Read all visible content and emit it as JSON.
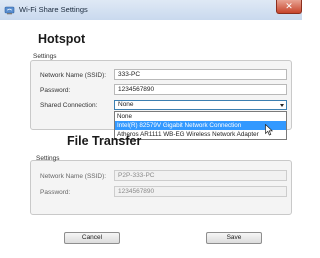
{
  "window": {
    "title": "Wi-Fi Share Settings",
    "close_glyph": "✕",
    "app_icon": "wifi-app-icon"
  },
  "hotspot": {
    "heading": "Hotspot",
    "group_label": "Settings",
    "ssid_label": "Network Name (SSID):",
    "ssid_value": "333-PC",
    "password_label": "Password:",
    "password_value": "1234567890",
    "shared_label": "Shared Connection:",
    "shared_value": "None",
    "options": [
      "None",
      "Intel(R) 82579V Gigabit Network Connection",
      "Atheros AR1111 WB-EG Wireless Network Adapter"
    ],
    "highlighted_option": 1
  },
  "file_transfer": {
    "heading": "File Transfer",
    "group_label": "Settings",
    "ssid_label": "Network Name (SSID):",
    "ssid_value": "P2P-333-PC",
    "password_label": "Password:",
    "password_value": "1234567890"
  },
  "buttons": {
    "cancel": "Cancel",
    "save": "Save"
  },
  "colors": {
    "selection": "#3399ff",
    "title_bar": "#c9d9ee",
    "close": "#c7442b"
  }
}
